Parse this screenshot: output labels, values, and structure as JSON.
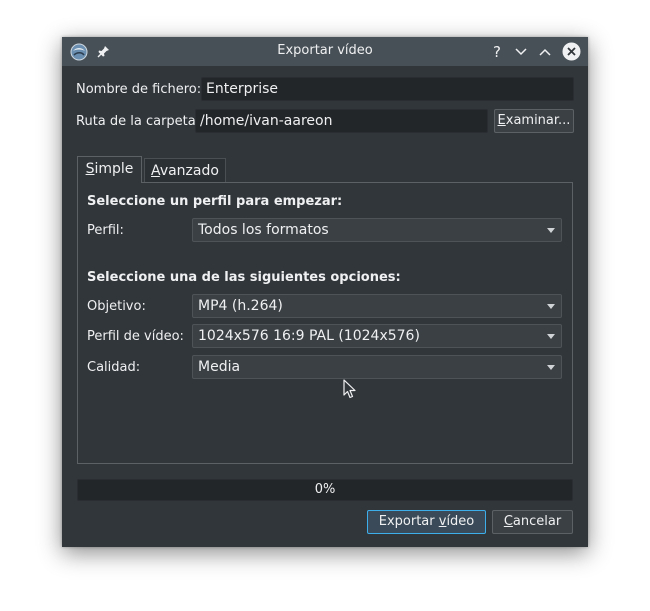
{
  "window": {
    "title": "Exportar vídeo",
    "help_glyph": "?"
  },
  "form": {
    "filename_label": "Nombre de fichero:",
    "filename_value": "Enterprise",
    "folder_label": "Ruta de la carpeta:",
    "folder_value": "/home/ivan-aareon",
    "browse_label_mnemonic": "E",
    "browse_label_rest": "xaminar..."
  },
  "tabs": [
    {
      "mnemonic": "S",
      "rest": "imple",
      "active": true
    },
    {
      "mnemonic": "A",
      "rest": "vanzado",
      "active": false
    }
  ],
  "simple": {
    "profile_section": "Seleccione un perfil para empezar:",
    "profile_label": "Perfil:",
    "profile_value": "Todos los formatos",
    "options_section": "Seleccione una de las siguientes opciones:",
    "target_label": "Objetivo:",
    "target_value": "MP4 (h.264)",
    "video_profile_label": "Perfil de vídeo:",
    "video_profile_value": "1024x576 16:9 PAL (1024x576)",
    "quality_label": "Calidad:",
    "quality_value": "Media"
  },
  "progress": {
    "value": 0,
    "text": "0%"
  },
  "buttons": {
    "export_before": "Exportar ",
    "export_mnemonic": "v",
    "export_after": "ídeo",
    "cancel_mnemonic": "C",
    "cancel_rest": "ancelar"
  },
  "colors": {
    "window_bg": "#31363b",
    "titlebar_bg": "#475057",
    "field_bg": "#232629",
    "accent": "#3daee9",
    "text": "#eff0f1"
  }
}
